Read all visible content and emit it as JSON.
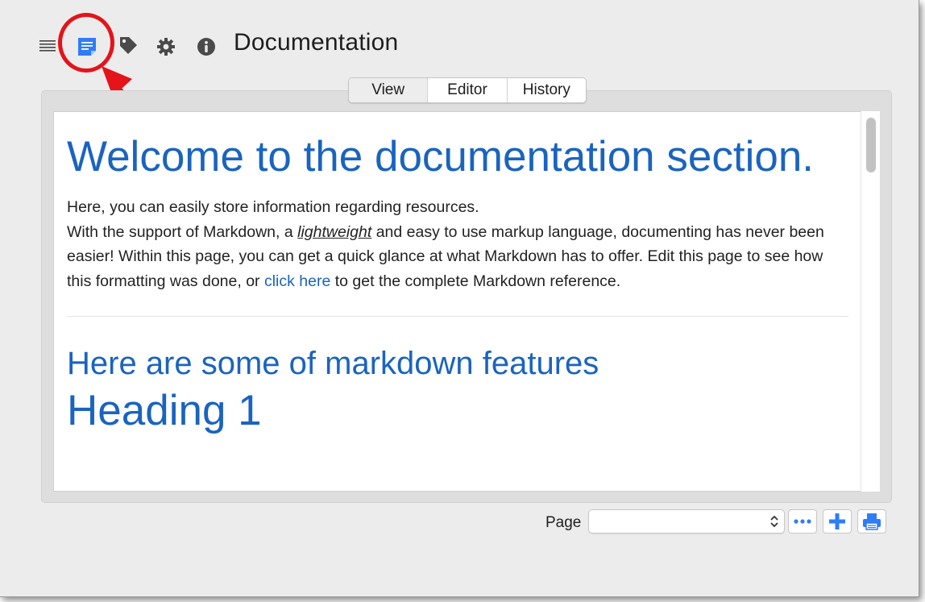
{
  "window": {
    "title": "Documentation"
  },
  "toolbar": {
    "icons": [
      "list-icon",
      "notes-icon",
      "tag-icon",
      "gear-icon",
      "info-icon"
    ],
    "accent": "#2f7df6"
  },
  "tabs": [
    {
      "label": "View",
      "selected": true
    },
    {
      "label": "Editor",
      "selected": false
    },
    {
      "label": "History",
      "selected": false
    }
  ],
  "document": {
    "heading": "Welcome to the documentation section.",
    "intro_line1": "Here, you can easily store information regarding resources.",
    "intro_p1": "With the support of Markdown, a ",
    "intro_em": "lightweight",
    "intro_p2": " and easy to use markup language, documenting has never been easier! Within this page, you can get a quick glance at what Markdown has to offer. Edit this page to see how this formatting was done, or ",
    "intro_link": "click here",
    "intro_p3": " to get the complete Markdown reference.",
    "subheading": "Here are some of markdown features",
    "heading1_partial": "Heading 1",
    "link_color": "#1a64bf"
  },
  "bottom_bar": {
    "page_label": "Page",
    "page_value": "",
    "buttons": [
      "more-icon",
      "add-icon",
      "print-icon"
    ]
  },
  "annotation": {
    "color": "#e3141a"
  }
}
